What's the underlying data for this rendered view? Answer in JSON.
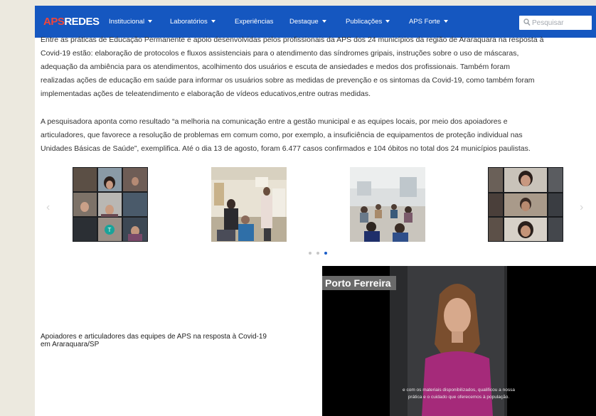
{
  "header": {
    "logo_aps": "APS",
    "logo_redes": "REDES",
    "nav": [
      {
        "label": "Institucional",
        "caret": true
      },
      {
        "label": "Laboratórios",
        "caret": true
      },
      {
        "label": "Experiências",
        "caret": false
      },
      {
        "label": "Destaque",
        "caret": true
      },
      {
        "label": "Publicações",
        "caret": true
      },
      {
        "label": "APS Forte",
        "caret": true
      }
    ],
    "search_placeholder": "Pesquisar"
  },
  "article": {
    "paragraph1": [
      "Entre as práticas de Educação Permanente e apoio desenvolvidas pelos profissionais da APS dos 24 municípios da região de Araraquara na resposta à",
      "Covid-19 estão: elaboração de protocolos e fluxos assistenciais para o atendimento das síndromes gripais, instruções sobre o uso de máscaras,",
      "adequação da ambiência para os atendimentos, acolhimento dos usuários e escuta de ansiedades e medos dos profissionais. Também foram",
      "realizadas ações de educação em saúde para informar os usuários sobre as medidas de prevenção e os sintomas da Covid-19, como também foram",
      "implementadas ações de teleatendimento e elaboração de vídeos educativos,entre outras medidas."
    ],
    "paragraph2": [
      "A pesquisadora aponta como resultado “a melhoria na comunicação entre a gestão municipal e as equipes locais, por meio dos apoiadores e",
      "articuladores, que  favorece a resolução de problemas em comum como, por exemplo, a insuficiência de equipamentos de proteção individual nas",
      "Unidades Básicas de Saúde”, exemplifica. Até o dia 13 de agosto, foram 6.477 casos confirmados e 104 óbitos no total dos 24 municípios paulistas."
    ]
  },
  "carousel": {
    "dots_total": 3,
    "active_dot": 3,
    "video_call_avatar_letter": "T"
  },
  "video_section": {
    "caption": [
      "Apoiadores e articuladores das equipes de APS na resposta à Covid-19",
      "em Araraquara/SP"
    ],
    "video_title": "Porto Ferreira",
    "subtitle": [
      "e com os materiais disponibilizados, qualificou a nossa",
      "prática e o cuidado que oferecemos à população."
    ]
  },
  "colors": {
    "header_bg": "#1557c0",
    "logo_accent": "#f2463a",
    "active_dot": "#1a5dc8"
  }
}
